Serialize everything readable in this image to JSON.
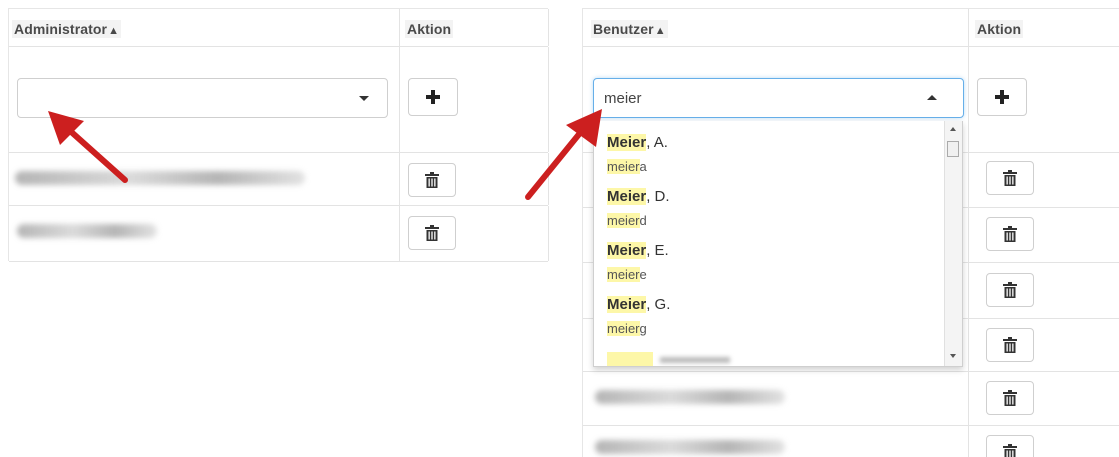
{
  "admin_table": {
    "header": {
      "col1": "Administrator",
      "col2": "Aktion",
      "sort_indicator": "▲"
    },
    "select_value": "",
    "add_button_icon": "plus-icon",
    "rows": [
      {
        "name": "",
        "action_icon": "trash-icon"
      },
      {
        "name": "",
        "action_icon": "trash-icon"
      }
    ]
  },
  "user_table": {
    "header": {
      "col1": "Benutzer",
      "col2": "Aktion",
      "sort_indicator": "▲"
    },
    "select_value": "meier",
    "add_button_icon": "plus-icon",
    "rows": [
      {
        "name": "",
        "action_icon": "trash-icon"
      },
      {
        "name": "",
        "action_icon": "trash-icon"
      },
      {
        "name": "",
        "action_icon": "trash-icon"
      },
      {
        "name": "",
        "action_icon": "trash-icon"
      },
      {
        "name": "",
        "action_icon": "trash-icon"
      },
      {
        "name": "",
        "action_icon": "trash-icon"
      }
    ]
  },
  "dropdown": {
    "options": [
      {
        "surname": "Meier",
        "initial": ", A.",
        "login_match": "meier",
        "login_rest": "a"
      },
      {
        "surname": "Meier",
        "initial": ", D.",
        "login_match": "meier",
        "login_rest": "d"
      },
      {
        "surname": "Meier",
        "initial": ", E.",
        "login_match": "meier",
        "login_rest": "e"
      },
      {
        "surname": "Meier",
        "initial": ", G.",
        "login_match": "meier",
        "login_rest": "g"
      }
    ]
  },
  "colors": {
    "annotation_arrow": "#cc1f1f",
    "highlight": "#fdf7a8",
    "header_bg": "#f3f3f3",
    "focus_border": "#66afe9"
  }
}
